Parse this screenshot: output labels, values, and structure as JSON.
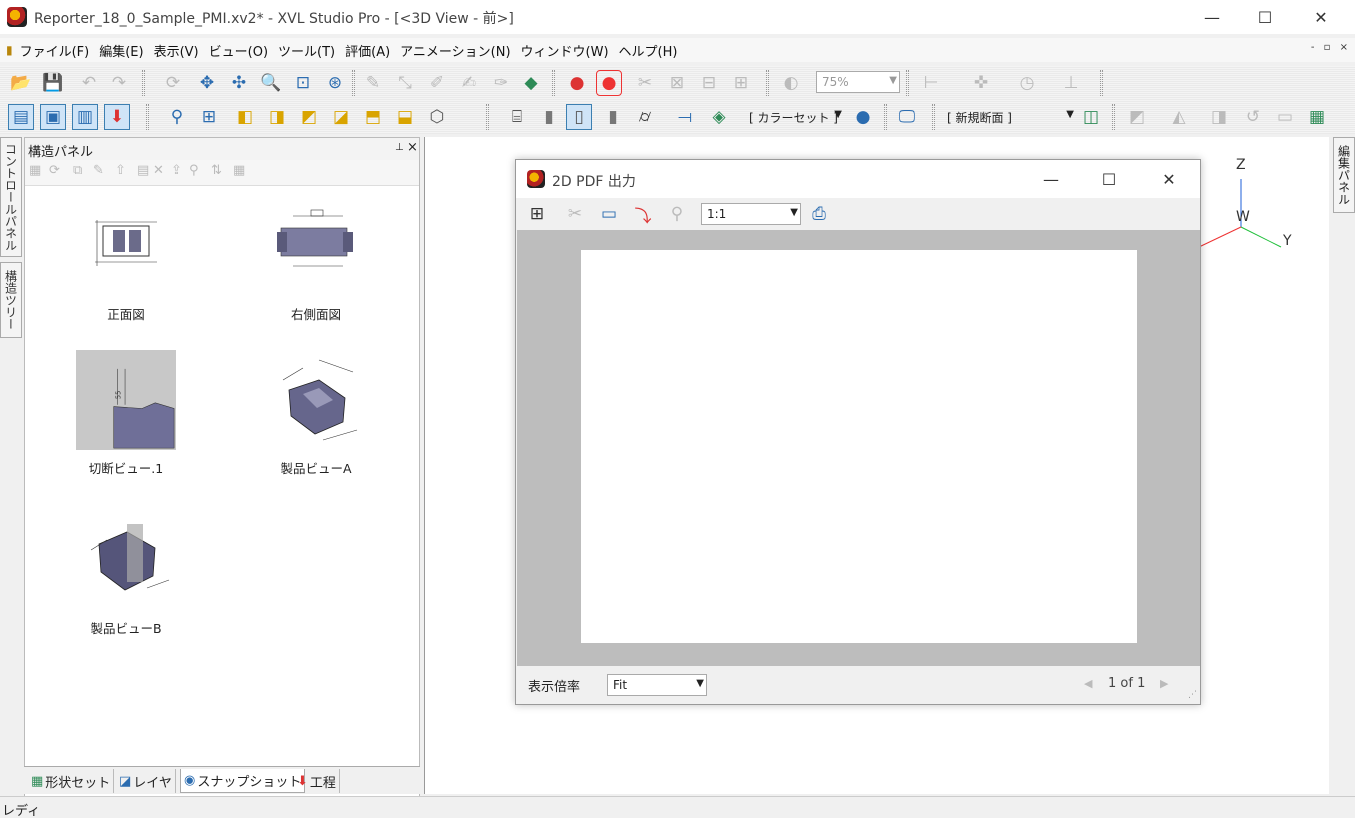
{
  "window": {
    "title": "Reporter_18_0_Sample_PMI.xv2* - XVL Studio Pro - [<3D View - 前>]",
    "minimize": "—",
    "maximize": "☐",
    "close": "✕"
  },
  "menu": {
    "items": [
      "ファイル(F)",
      "編集(E)",
      "表示(V)",
      "ビュー(O)",
      "ツール(T)",
      "評価(A)",
      "アニメーション(N)",
      "ウィンドウ(W)",
      "ヘルプ(H)"
    ],
    "mdi_controls": "- ▫ ×"
  },
  "toolbar": {
    "zoom_value": "75%",
    "color_set": "[ カラーセット ]",
    "section": "[ 新規断面 ]"
  },
  "side_tabs": {
    "control_panel": "コントロールパネル",
    "structure_tree": "構造ツリー",
    "edit_panel": "編集パネル"
  },
  "structure_panel": {
    "title": "構造パネル",
    "pin": "⊥",
    "close": "×",
    "views": [
      {
        "label": "正面図"
      },
      {
        "label": "右側面図"
      },
      {
        "label": "切断ビュー.1"
      },
      {
        "label": "製品ビューA"
      },
      {
        "label": "製品ビューB"
      }
    ],
    "bottom_tabs": [
      "形状セット",
      "レイヤ",
      "スナップショット",
      "工程"
    ]
  },
  "axes": {
    "z": "Z",
    "w": "W",
    "y": "Y"
  },
  "dialog": {
    "title": "2D PDF 出力",
    "minimize": "—",
    "maximize": "☐",
    "close": "✕",
    "scale_value": "1:1",
    "zoom_label": "表示倍率",
    "zoom_value": "Fit",
    "page_info": "1 of 1",
    "prev": "◀",
    "next": "▶"
  },
  "status": {
    "text": "レディ"
  }
}
